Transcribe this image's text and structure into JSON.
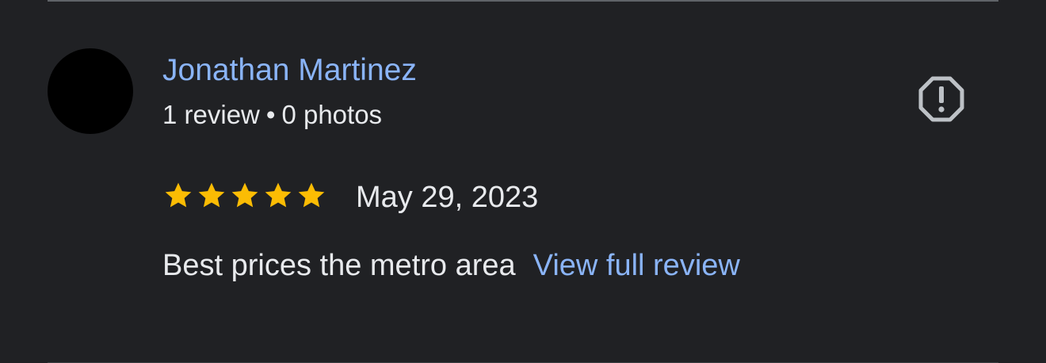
{
  "review": {
    "author_name": "Jonathan Martinez",
    "review_count": "1 review",
    "separator": "•",
    "photo_count": "0 photos",
    "rating": 5,
    "max_rating": 5,
    "date": "May 29, 2023",
    "text": "Best prices the metro area",
    "view_full_label": "View full review",
    "report_icon": "report-octagon-exclamation-icon"
  },
  "colors": {
    "background": "#202124",
    "link": "#8ab4f8",
    "text": "#e8eaed",
    "star": "#fbbc04",
    "icon": "#bdc1c6"
  }
}
